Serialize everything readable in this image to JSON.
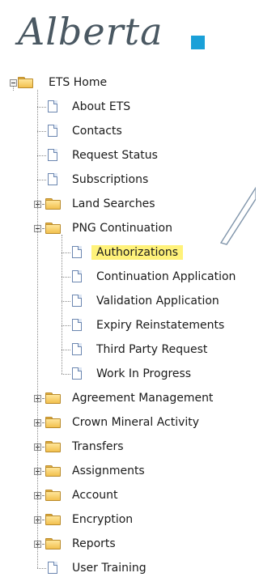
{
  "logo": {
    "text": "Alberta",
    "mark_color": "#1aa0d8"
  },
  "tree": {
    "root": {
      "label": "ETS Home",
      "expander": "minus"
    },
    "items": [
      {
        "label": "About ETS",
        "icon": "page-icon"
      },
      {
        "label": "Contacts",
        "icon": "page-icon"
      },
      {
        "label": "Request Status",
        "icon": "page-icon"
      },
      {
        "label": "Subscriptions",
        "icon": "page-icon"
      },
      {
        "label": "Land Searches",
        "icon": "folder-icon",
        "expander": "plus"
      },
      {
        "label": "PNG Continuation",
        "icon": "folder-icon",
        "expander": "minus",
        "children": [
          {
            "label": "Authorizations",
            "icon": "page-icon",
            "highlighted": true
          },
          {
            "label": "Continuation Application",
            "icon": "page-icon"
          },
          {
            "label": "Validation Application",
            "icon": "page-icon"
          },
          {
            "label": "Expiry Reinstatements",
            "icon": "page-icon"
          },
          {
            "label": "Third Party Request",
            "icon": "page-icon"
          },
          {
            "label": "Work In Progress",
            "icon": "page-icon"
          }
        ]
      },
      {
        "label": "Agreement Management",
        "icon": "folder-icon",
        "expander": "plus"
      },
      {
        "label": "Crown Mineral Activity",
        "icon": "folder-icon",
        "expander": "plus"
      },
      {
        "label": "Transfers",
        "icon": "folder-icon",
        "expander": "plus"
      },
      {
        "label": "Assignments",
        "icon": "folder-icon",
        "expander": "plus"
      },
      {
        "label": "Account",
        "icon": "folder-icon",
        "expander": "plus"
      },
      {
        "label": "Encryption",
        "icon": "folder-icon",
        "expander": "plus"
      },
      {
        "label": "Reports",
        "icon": "folder-icon",
        "expander": "plus"
      },
      {
        "label": "User Training",
        "icon": "page-icon"
      }
    ]
  },
  "colors": {
    "highlight": "#fff27a",
    "callout": "#7f94aa"
  }
}
